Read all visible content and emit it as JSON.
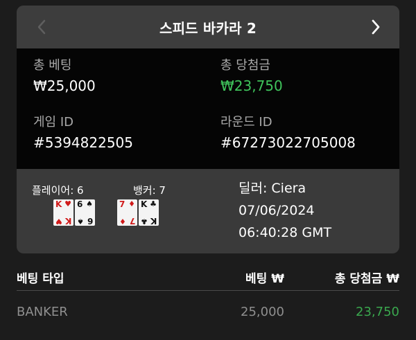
{
  "header": {
    "title": "스피드 바카라 2",
    "prev_icon": "chevron-left-icon",
    "next_icon": "chevron-right-icon"
  },
  "summary": {
    "total_bet_label": "총 베팅",
    "total_bet_value": "₩25,000",
    "total_win_label": "총 당첨금",
    "total_win_value": "₩23,750",
    "game_id_label": "게임 ID",
    "game_id_value": "#5394822505",
    "round_id_label": "라운드 ID",
    "round_id_value": "#67273022705008"
  },
  "hands": {
    "player_label": "플레이어: 6",
    "banker_label": "뱅커: 7",
    "player_cards": [
      {
        "rank": "K",
        "suit": "♥",
        "color": "red"
      },
      {
        "rank": "6",
        "suit": "♠",
        "color": "black"
      }
    ],
    "banker_cards": [
      {
        "rank": "7",
        "suit": "♦",
        "color": "red"
      },
      {
        "rank": "K",
        "suit": "♣",
        "color": "black"
      }
    ]
  },
  "round": {
    "dealer": "딜러: Ciera",
    "date": "07/06/2024",
    "time": "06:40:28 GMT"
  },
  "bets_table": {
    "headers": {
      "type": "베팅 타입",
      "bet": "베팅 ₩",
      "win": "총 당첨금 ₩"
    },
    "rows": [
      {
        "type": "BANKER",
        "bet": "25,000",
        "win": "23,750"
      }
    ]
  },
  "colors": {
    "background": "#1c1c1c",
    "panel": "#3a3a3a",
    "info_bg": "#050505",
    "win_green": "#3fc35b",
    "card_red": "#d01a1a"
  }
}
